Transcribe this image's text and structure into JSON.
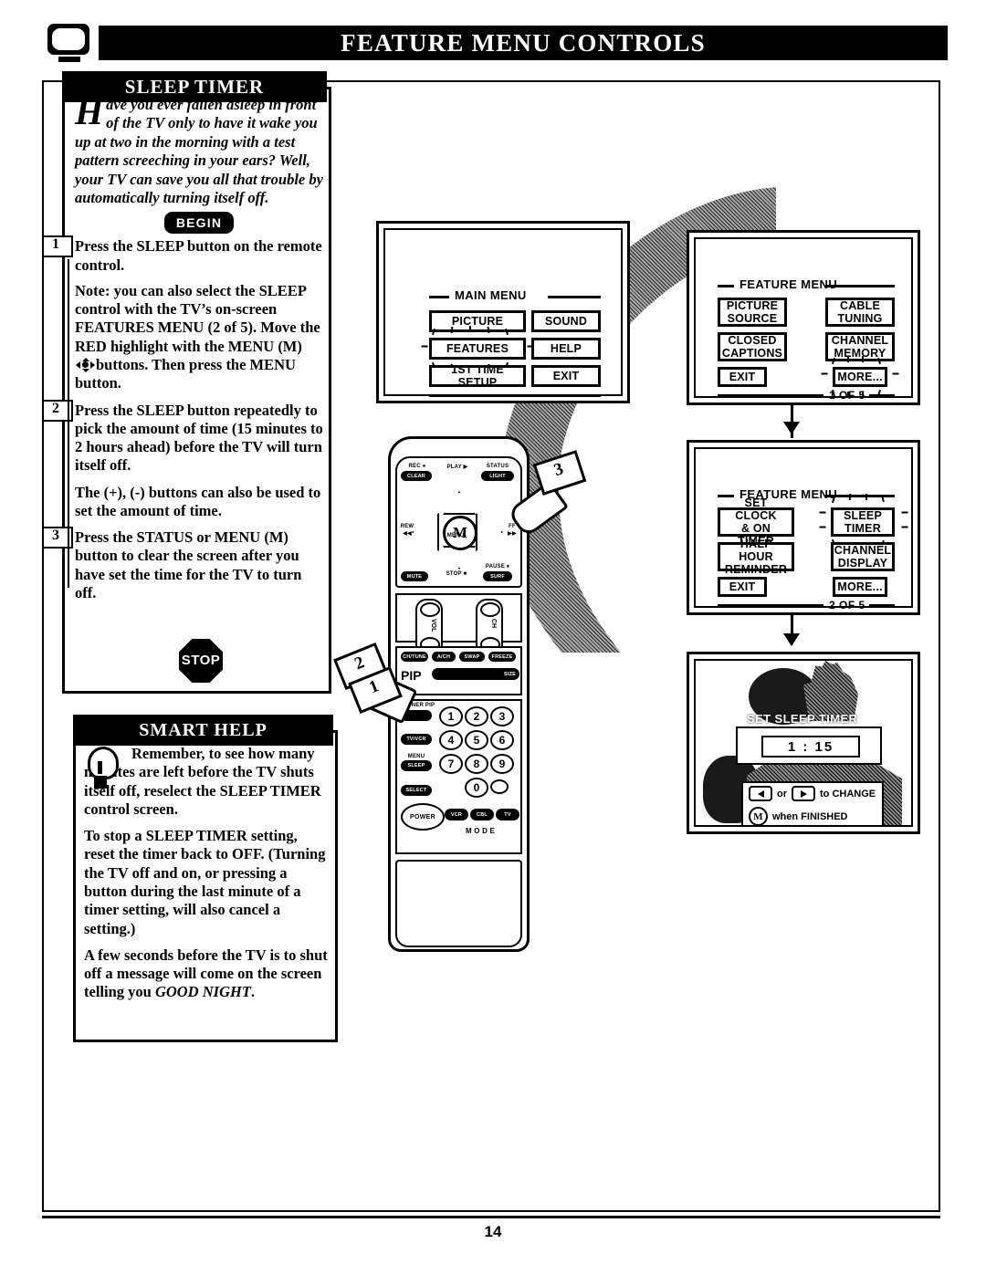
{
  "page": {
    "header_title": "FEATURE MENU CONTROLS",
    "page_number": "14",
    "corner_icon": "tv-screen-icon"
  },
  "sleep_section": {
    "tab_label": "SLEEP TIMER",
    "intro_dropcap": "H",
    "intro_text": "ave you ever fallen asleep in front of the TV only to have it wake you up at two in the morning with a test pattern screeching in your ears?  Well, your TV can save you all that trouble by automatically turning itself off.",
    "begin_label": "BEGIN",
    "steps": [
      {
        "number": "1",
        "lead": "Press the SLEEP",
        "rest": " button on the remote control.",
        "note": "Note: you can also select the SLEEP control with the TV’s on-screen FEATURES MENU (2 of 5). Move the RED highlight with the MENU (M) ",
        "note_tail": "buttons. Then press the MENU button."
      },
      {
        "number": "2",
        "lead": "Press the SLEEP button",
        "rest": " repeatedly to pick the amount of time (15 minutes to 2 hours ahead) before the TV will turn itself off.",
        "extra": "The (+), (-) buttons can also be used to set the amount of time."
      },
      {
        "number": "3",
        "lead": "Press the STATUS or MENU",
        "rest": " (M) button to clear the screen after you have set the time for the TV to turn off."
      }
    ],
    "stop_label": "STOP"
  },
  "smart_help": {
    "tab_label": "SMART HELP",
    "icon": "lightbulb-icon",
    "paragraphs": [
      "Remember,  to see how many minutes are left before the TV shuts itself off, reselect the SLEEP TIMER control screen.",
      "To stop a SLEEP TIMER setting, reset the timer back to OFF. (Turning the TV off and on, or pressing a button during the last minute of a timer setting, will also cancel a setting.)",
      "A few seconds before the TV is to shut off a message will come on the screen telling you GOOD NIGHT."
    ],
    "good_night": "GOOD NIGHT"
  },
  "screens": {
    "main_menu": {
      "title": "MAIN MENU",
      "buttons": [
        {
          "label": "PICTURE",
          "highlighted": false
        },
        {
          "label": "SOUND",
          "highlighted": false
        },
        {
          "label": "FEATURES",
          "highlighted": true
        },
        {
          "label": "HELP",
          "highlighted": false
        },
        {
          "label": "1ST TIME SETUP",
          "highlighted": false
        },
        {
          "label": "EXIT",
          "highlighted": false
        }
      ]
    },
    "feature_menu_1": {
      "title": "FEATURE MENU",
      "page_indicator": "1 OF 5",
      "buttons": [
        {
          "label": "PICTURE\nSOURCE",
          "highlighted": false
        },
        {
          "label": "CABLE\nTUNING",
          "highlighted": false
        },
        {
          "label": "CLOSED\nCAPTIONS",
          "highlighted": false
        },
        {
          "label": "CHANNEL\nMEMORY",
          "highlighted": false
        },
        {
          "label": "EXIT",
          "highlighted": false
        },
        {
          "label": "MORE...",
          "highlighted": true
        }
      ]
    },
    "feature_menu_2": {
      "title": "FEATURE MENU",
      "page_indicator": "2 OF 5",
      "buttons": [
        {
          "label": "SET CLOCK\n& ON TIMER",
          "highlighted": false
        },
        {
          "label": "SLEEP\nTIMER",
          "highlighted": true
        },
        {
          "label": "HALF HOUR\nREMINDER",
          "highlighted": false
        },
        {
          "label": "CHANNEL\nDISPLAY",
          "highlighted": false
        },
        {
          "label": "EXIT",
          "highlighted": false
        },
        {
          "label": "MORE...",
          "highlighted": false
        }
      ]
    },
    "set_sleep_timer": {
      "title": "SET SLEEP TIMER",
      "value": "1 : 15",
      "instruction_change": "to CHANGE",
      "instruction_change_or": "or",
      "instruction_finished": "when FINISHED",
      "finished_key": "M"
    }
  },
  "remote": {
    "top_buttons": [
      {
        "label": "REC ●",
        "name": "rec-label"
      },
      {
        "label": "CLEAR",
        "name": "clear-button"
      },
      {
        "label": "PLAY ▶",
        "name": "play-label"
      },
      {
        "label": "STATUS",
        "name": "status-label"
      },
      {
        "label": "LIGHT",
        "name": "light-button"
      }
    ],
    "dpad_center": "M",
    "dpad_label": "MENU",
    "side_labels": {
      "rew": "REW",
      "rew_icon": "◀◀",
      "ff": "FF",
      "ff_icon": "▶▶",
      "stop": "STOP ■",
      "pause": "PAUSE ⏸"
    },
    "mute_label": "MUTE",
    "surf_label": "SURF",
    "vol_label": "VOL",
    "ch_label": "CH",
    "source_row": [
      "CH/TUNE",
      "A/CH",
      "SWAP",
      "FREEZE"
    ],
    "pip_label": "PIP",
    "pip_size": "SIZE",
    "two_tuner_label": "2 TUNER PIP",
    "tv_vcr_label": "TV/VCR",
    "sleep_label": "SLEEP",
    "sleep_small": "MENU",
    "select_label": "SELECT",
    "keypad": [
      "1",
      "2",
      "3",
      "4",
      "5",
      "6",
      "7",
      "8",
      "9",
      "0"
    ],
    "power_label": "POWER",
    "mode_buttons": [
      "VCR",
      "CBL",
      "TV"
    ],
    "mode_label": "M  O  D  E",
    "callouts": [
      "1",
      "2",
      "3"
    ]
  }
}
